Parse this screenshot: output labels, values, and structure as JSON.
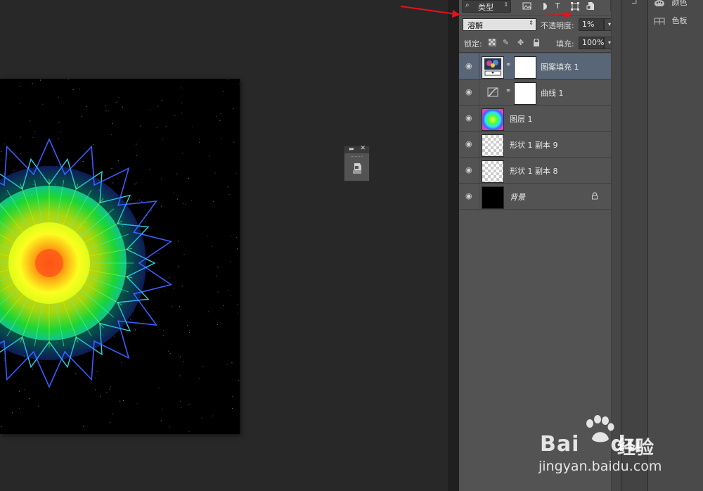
{
  "toolbar": {
    "filter_kind_label": "类型",
    "filter_kind_arrows": "⇕",
    "filter_icons": [
      "image-filter-icon",
      "adjustment-filter-icon",
      "type-filter-icon",
      "shape-filter-icon",
      "smart-object-filter-icon"
    ],
    "type_glyph": "T"
  },
  "blend": {
    "mode": "溶解",
    "opacity_label": "不透明度:",
    "opacity_value": "1%",
    "dropdown_glyph": "▾"
  },
  "lock": {
    "label": "锁定:",
    "icons": [
      "lock-transparent-pixels-icon",
      "lock-image-pixels-icon",
      "lock-position-icon",
      "lock-all-icon"
    ],
    "fill_label": "填充:",
    "fill_value": "100%"
  },
  "layers": [
    {
      "name": "图案填充 1",
      "selected": true,
      "thumb": "pattern",
      "mask": true
    },
    {
      "name": "曲线 1",
      "selected": false,
      "thumb": "curves",
      "mask": true
    },
    {
      "name": "图层 1",
      "selected": false,
      "thumb": "rainbow",
      "mask": false
    },
    {
      "name": "形状 1 副本 9",
      "selected": false,
      "thumb": "transparent",
      "mask": false
    },
    {
      "name": "形状 1 副本 8",
      "selected": false,
      "thumb": "transparent",
      "mask": false
    },
    {
      "name": "背景",
      "selected": false,
      "thumb": "black",
      "mask": false,
      "locked": true
    }
  ],
  "dock": {
    "items": [
      {
        "label": "颜色",
        "icon": "color-palette-icon"
      },
      {
        "label": "色板",
        "icon": "swatches-grid-icon"
      }
    ]
  },
  "watermark": {
    "brand": "Bai",
    "brand_tail": "du",
    "cn": "经验",
    "url": "jingyan.baidu.com"
  },
  "colors": {
    "panel_bg": "#535353",
    "selected_row": "#596677",
    "canvas_bg": "#282828",
    "arrow_red": "#e8101a"
  }
}
